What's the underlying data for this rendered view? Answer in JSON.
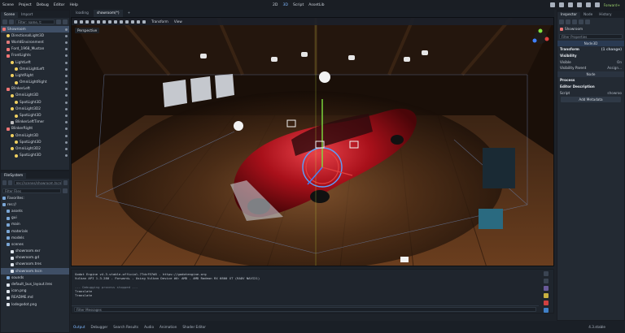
{
  "menu": [
    "Scene",
    "Project",
    "Debug",
    "Editor",
    "Help"
  ],
  "workspaces": [
    "2D",
    "3D",
    "Script",
    "AssetLib"
  ],
  "active_workspace": "3D",
  "renderer": "Forward+",
  "scene_dock": {
    "tabs": [
      "Scene",
      "Import"
    ],
    "filter_placeholder": "Filter: name, t:",
    "nodes": [
      {
        "label": "Showroom",
        "icon": "node3d",
        "selected": true,
        "indent": 0
      },
      {
        "label": "DirectionalLight3D",
        "icon": "light",
        "indent": 1
      },
      {
        "label": "WorldEnvironment",
        "icon": "env",
        "indent": 1
      },
      {
        "label": "Ford_1968_Mustan",
        "icon": "node3d",
        "indent": 1
      },
      {
        "label": "FrontLights",
        "icon": "node3d",
        "indent": 1
      },
      {
        "label": "LightLeft",
        "icon": "light",
        "indent": 2
      },
      {
        "label": "OmniLightLeft",
        "icon": "light",
        "indent": 3
      },
      {
        "label": "LightRight",
        "icon": "light",
        "indent": 2
      },
      {
        "label": "OmniLightRight",
        "icon": "light",
        "indent": 3
      },
      {
        "label": "BlinkerLeft",
        "icon": "node3d",
        "indent": 1
      },
      {
        "label": "OmniLight3D",
        "icon": "light",
        "indent": 2
      },
      {
        "label": "SpotLight3D",
        "icon": "light",
        "indent": 3
      },
      {
        "label": "OmniLight3D2",
        "icon": "light",
        "indent": 2
      },
      {
        "label": "SpotLight3D",
        "icon": "light",
        "indent": 3
      },
      {
        "label": "BlinkerLeftTimer",
        "icon": "timer",
        "indent": 2
      },
      {
        "label": "BlinkerRight",
        "icon": "node3d",
        "indent": 1
      },
      {
        "label": "OmniLight3D",
        "icon": "light",
        "indent": 2
      },
      {
        "label": "SpotLight3D",
        "icon": "light",
        "indent": 3
      },
      {
        "label": "OmniLight3D2",
        "icon": "light",
        "indent": 2
      },
      {
        "label": "SpotLight3D",
        "icon": "light",
        "indent": 3
      }
    ]
  },
  "filesystem": {
    "title": "FileSystem",
    "path": "res://scenes/showroom.tscn",
    "filter_placeholder": "Filter Files",
    "items": [
      {
        "label": "Favorites:",
        "kind": "folder",
        "indent": 0
      },
      {
        "label": "res://",
        "kind": "folder",
        "indent": 0
      },
      {
        "label": "assets",
        "kind": "folder",
        "indent": 1
      },
      {
        "label": "gui",
        "kind": "folder",
        "indent": 1
      },
      {
        "label": "main",
        "kind": "folder",
        "indent": 1
      },
      {
        "label": "materials",
        "kind": "folder",
        "indent": 1
      },
      {
        "label": "models",
        "kind": "folder",
        "indent": 1
      },
      {
        "label": "scenes",
        "kind": "folder",
        "indent": 1
      },
      {
        "label": "showroom.exr",
        "kind": "file",
        "indent": 2
      },
      {
        "label": "showroom.gd",
        "kind": "file",
        "indent": 2
      },
      {
        "label": "showroom.tres",
        "kind": "file",
        "indent": 2
      },
      {
        "label": "showroom.tscn",
        "kind": "file",
        "indent": 2,
        "selected": true
      },
      {
        "label": "sounds",
        "kind": "folder",
        "indent": 1
      },
      {
        "label": "default_bus_layout.tres",
        "kind": "file",
        "indent": 1
      },
      {
        "label": "icon.png",
        "kind": "file",
        "indent": 1
      },
      {
        "label": "README.md",
        "kind": "file",
        "indent": 1
      },
      {
        "label": "lodegodot.png",
        "kind": "file",
        "indent": 1
      }
    ]
  },
  "viewport": {
    "tabs": [
      "loading",
      "showroom(*)"
    ],
    "view_labels": [
      "Transform",
      "View"
    ],
    "perspective_label": "Perspective"
  },
  "inspector": {
    "tabs": [
      "Inspector",
      "Node",
      "History"
    ],
    "object_name": "Showroom",
    "filter_placeholder": "Filter Properties",
    "class_name": "Node3D",
    "rows": [
      {
        "label": "Transform",
        "value": "(1 change)",
        "header": true
      },
      {
        "label": "Visibility",
        "value": "",
        "header": true
      },
      {
        "label": "Visible",
        "value": "On"
      },
      {
        "label": "Visibility Parent",
        "value": "Assign..."
      }
    ],
    "section_node": "Node",
    "process_label": "Process",
    "editor_desc_label": "Editor Description",
    "script_label": "Script",
    "script_value": "showroo",
    "add_metadata": "Add Metadata"
  },
  "output": {
    "lines": [
      "Godot Engine v4.3.stable.official.77dcf97d8 - https://godotengine.org",
      "Vulkan API 1.3.280 - Forward+ - Using Vulkan Device #0: AMD - AMD Radeon RX 6800 XT (RADV NAVI21)",
      "",
      "--- Debugging process stopped ---",
      "Translate",
      "Translate"
    ],
    "filter_placeholder": "Filter Messages"
  },
  "bottom_tabs": [
    "Output",
    "Debugger",
    "Search Results",
    "Audio",
    "Animation",
    "Shader Editor"
  ],
  "version": "4.3.stable",
  "colors": {
    "accent": "#7fb8ff",
    "car": "#b01218",
    "selection": "#3f4f66"
  }
}
